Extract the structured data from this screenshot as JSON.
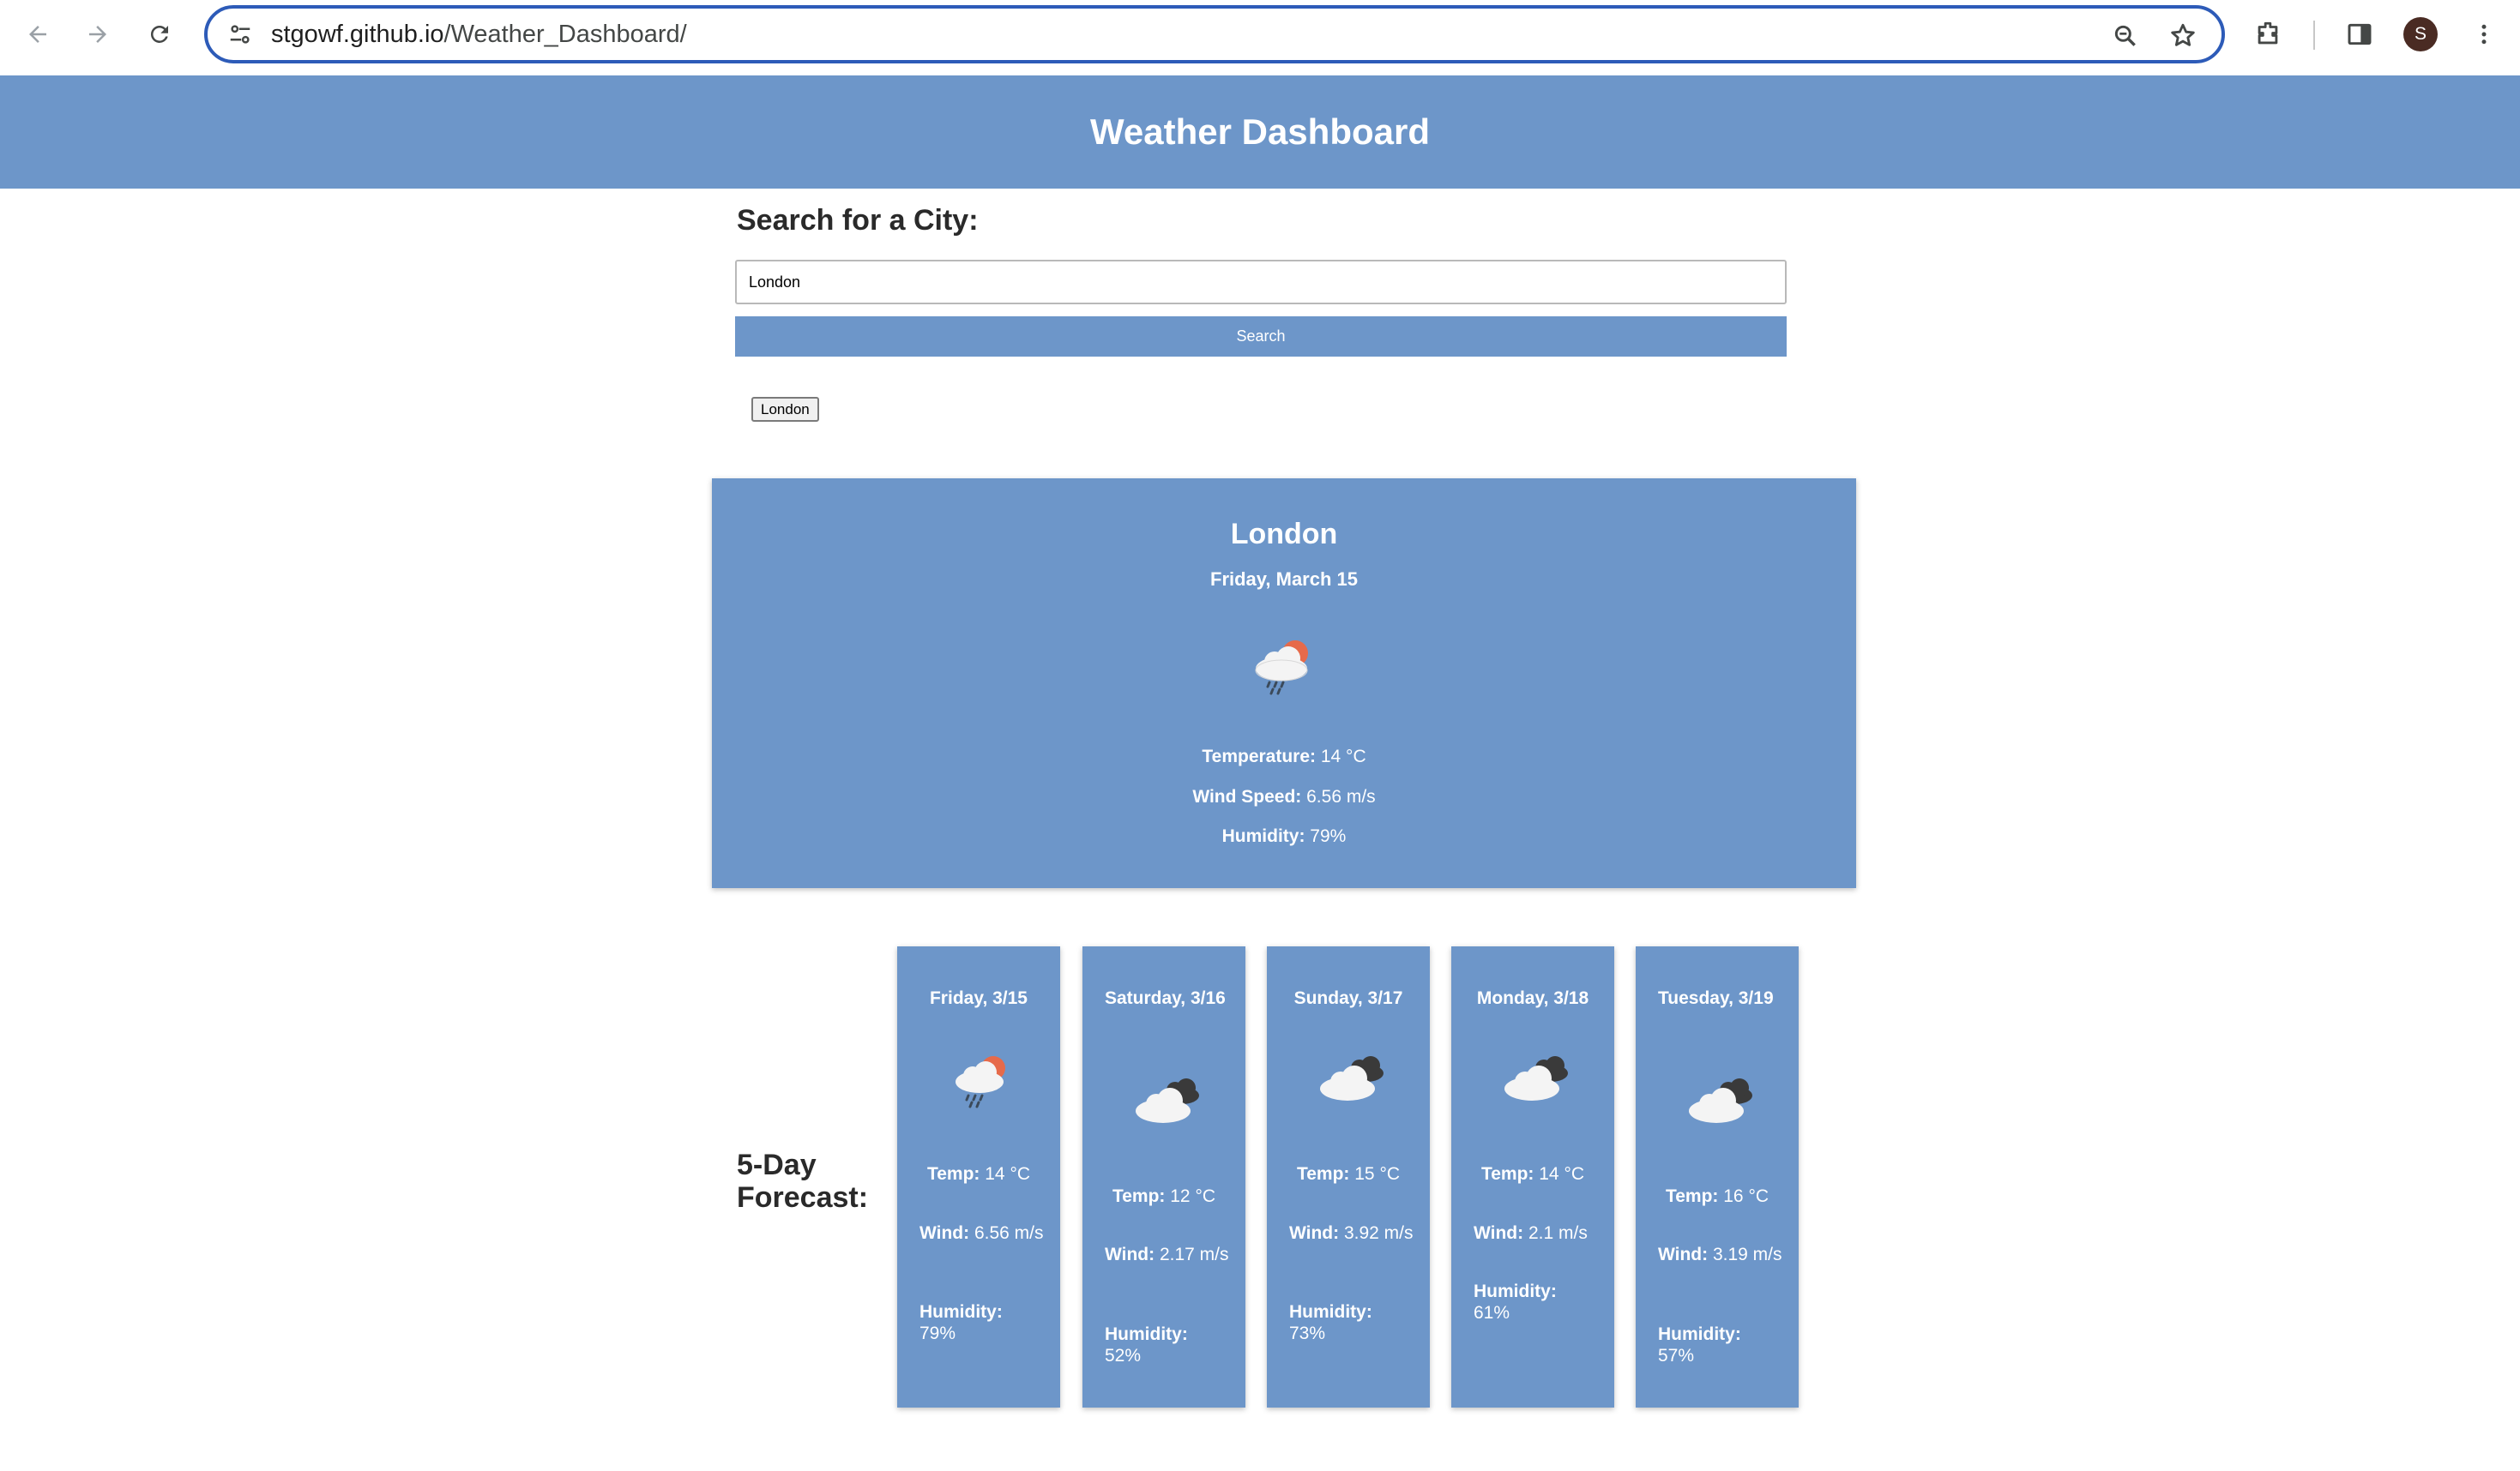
{
  "browser": {
    "url_host": "stgowf.github.io",
    "url_path": "/Weather_Dashboard/",
    "avatar_initial": "S"
  },
  "header": {
    "title": "Weather Dashboard"
  },
  "search": {
    "label": "Search for a City:",
    "input_value": "London",
    "button_label": "Search",
    "history": [
      "London"
    ]
  },
  "current": {
    "city": "London",
    "date": "Friday, March 15",
    "icon": "cloud-sun-rain-icon",
    "temperature_label": "Temperature:",
    "temperature_value": " 14 °C",
    "wind_label": "Wind Speed:",
    "wind_value": " 6.56 m/s",
    "humidity_label": "Humidity:",
    "humidity_value": " 79%"
  },
  "forecast": {
    "label_line1": "5-Day",
    "label_line2": "Forecast:",
    "temp_label": "Temp:",
    "wind_label": "Wind:",
    "humidity_label": "Humidity:",
    "days": [
      {
        "date": "Friday, 3/15",
        "icon": "cloud-sun-rain-icon",
        "temp": " 14 °C",
        "wind": " 6.56 m/s",
        "humidity": " 79%"
      },
      {
        "date": "Saturday, 3/16",
        "icon": "cloudy-icon",
        "temp": " 12 °C",
        "wind": " 2.17 m/s",
        "humidity": " 52%"
      },
      {
        "date": "Sunday, 3/17",
        "icon": "cloudy-icon",
        "temp": " 15 °C",
        "wind": " 3.92 m/s",
        "humidity": " 73%"
      },
      {
        "date": "Monday, 3/18",
        "icon": "cloudy-icon",
        "temp": " 14 °C",
        "wind": " 2.1 m/s",
        "humidity": " 61%"
      },
      {
        "date": "Tuesday, 3/19",
        "icon": "cloudy-icon",
        "temp": " 16 °C",
        "wind": " 3.19 m/s",
        "humidity": " 57%"
      }
    ]
  },
  "colors": {
    "accent": "#6d96c9",
    "omnibox_border": "#2d5bb8",
    "avatar": "#4a2b23"
  }
}
